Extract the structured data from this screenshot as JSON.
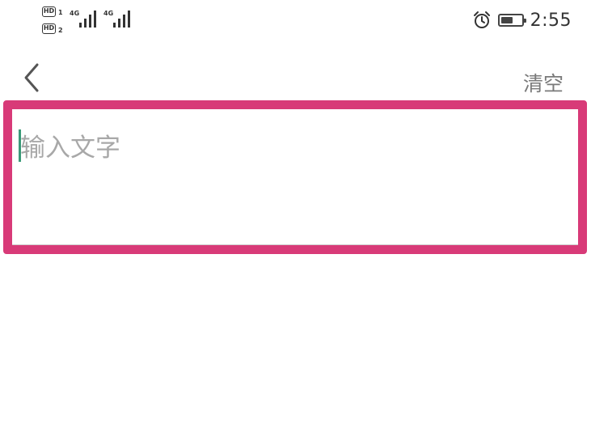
{
  "status_bar": {
    "sim1_badge": "HD",
    "sim2_badge": "HD",
    "sim1_number": "1",
    "sim2_number": "2",
    "network1": "4G",
    "network2": "4G",
    "battery_level": 0.6,
    "time": "2:55"
  },
  "nav": {
    "back_icon": "chevron-left-icon",
    "clear_label": "清空"
  },
  "input": {
    "placeholder": "输入文字",
    "value": "",
    "highlight_color": "#d83a78",
    "cursor_color": "#3a9a78"
  }
}
